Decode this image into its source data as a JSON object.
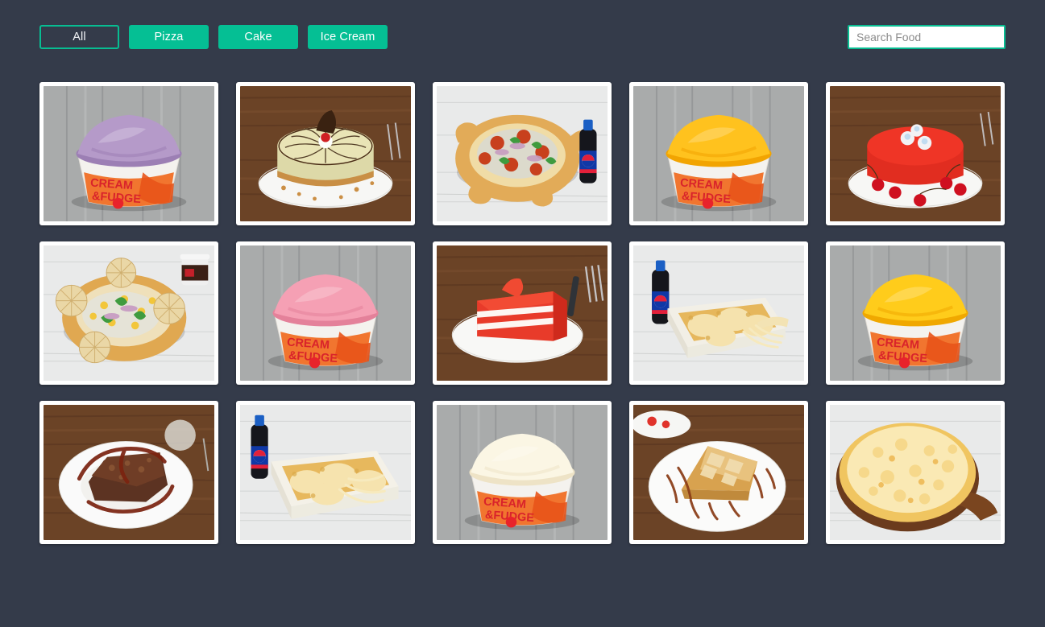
{
  "filters": [
    {
      "label": "All",
      "active": true,
      "name": "filter-all"
    },
    {
      "label": "Pizza",
      "active": false,
      "name": "filter-pizza"
    },
    {
      "label": "Cake",
      "active": false,
      "name": "filter-cake"
    },
    {
      "label": "Ice Cream",
      "active": false,
      "name": "filter-ice-cream"
    }
  ],
  "search": {
    "placeholder": "Search Food",
    "value": ""
  },
  "theme": {
    "background": "#343b4a",
    "accent": "#05bf94",
    "card_background": "#ffffff",
    "placeholder_text": "#8b8b8b"
  },
  "items": [
    {
      "name": "blueberry-ice-cream-cup",
      "category": "Ice Cream",
      "cup_brand": "CREAM & FUDGE",
      "surface": "grey-wood"
    },
    {
      "name": "butterscotch-pistachio-cake",
      "category": "Cake",
      "surface": "dark-wood"
    },
    {
      "name": "stuffed-crust-pizza-with-pepsi",
      "category": "Pizza",
      "surface": "white-wood"
    },
    {
      "name": "mango-ice-cream-cup",
      "category": "Ice Cream",
      "cup_brand": "CREAM & FUDGE",
      "surface": "grey-wood"
    },
    {
      "name": "red-velvet-cake-with-cherries",
      "category": "Cake",
      "surface": "dark-wood"
    },
    {
      "name": "momo-crust-pizza",
      "category": "Pizza",
      "surface": "white-wood"
    },
    {
      "name": "strawberry-ice-cream-cup",
      "category": "Ice Cream",
      "cup_brand": "CREAM & FUDGE",
      "surface": "grey-wood"
    },
    {
      "name": "red-velvet-cake-slice",
      "category": "Cake",
      "surface": "dark-wood"
    },
    {
      "name": "cheesy-baked-momos-with-pepsi",
      "category": "Pizza",
      "surface": "white-wood"
    },
    {
      "name": "mango-ice-cream-cup-2",
      "category": "Ice Cream",
      "cup_brand": "CREAM & FUDGE",
      "surface": "grey-wood"
    },
    {
      "name": "chocolate-brownie-with-sauce",
      "category": "Cake",
      "surface": "dark-wood"
    },
    {
      "name": "cheesy-baked-momos",
      "category": "Pizza",
      "surface": "white-wood"
    },
    {
      "name": "vanilla-ice-cream-cup",
      "category": "Ice Cream",
      "cup_brand": "CREAM & FUDGE",
      "surface": "grey-wood"
    },
    {
      "name": "apple-pie-slice-with-caramel",
      "category": "Cake",
      "surface": "dark-wood"
    },
    {
      "name": "cheese-pizza-on-board",
      "category": "Pizza",
      "surface": "white-wood"
    }
  ]
}
